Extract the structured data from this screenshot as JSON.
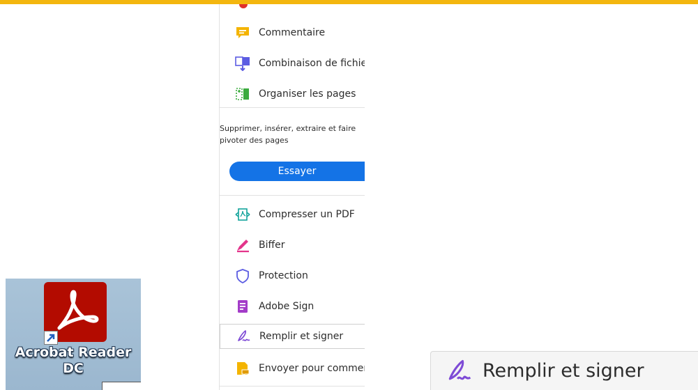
{
  "desktop_shortcut": {
    "label": "Acrobat Reader\nDC",
    "tile_color": "#b30b00",
    "icon": "acrobat-logo-icon"
  },
  "tools_panel": {
    "items_top": [
      {
        "label": "Commentaire",
        "icon": "comment-icon"
      },
      {
        "label": "Combinaison de fichiers",
        "icon": "combine-files-icon"
      },
      {
        "label": "Organiser les pages",
        "icon": "organize-pages-icon"
      }
    ],
    "promo": {
      "description": "Supprimer, insérer, extraire et faire pivoter des pages",
      "button_label": "Essayer"
    },
    "items_bottom": [
      {
        "label": "Compresser un PDF",
        "icon": "compress-pdf-icon"
      },
      {
        "label": "Biffer",
        "icon": "redact-icon"
      },
      {
        "label": "Protection",
        "icon": "shield-icon"
      },
      {
        "label": "Adobe Sign",
        "icon": "adobe-sign-icon"
      },
      {
        "label": "Remplir et signer",
        "icon": "fill-sign-icon",
        "selected": true
      },
      {
        "label": "Envoyer pour commentaires",
        "icon": "send-comments-icon"
      }
    ]
  },
  "zoom_callout": {
    "label": "Remplir et signer",
    "icon": "fill-sign-icon"
  },
  "colors": {
    "accent_bar": "#f3b60f",
    "button_blue": "#1473e6",
    "fill_sign_purple": "#7e4bd6"
  }
}
